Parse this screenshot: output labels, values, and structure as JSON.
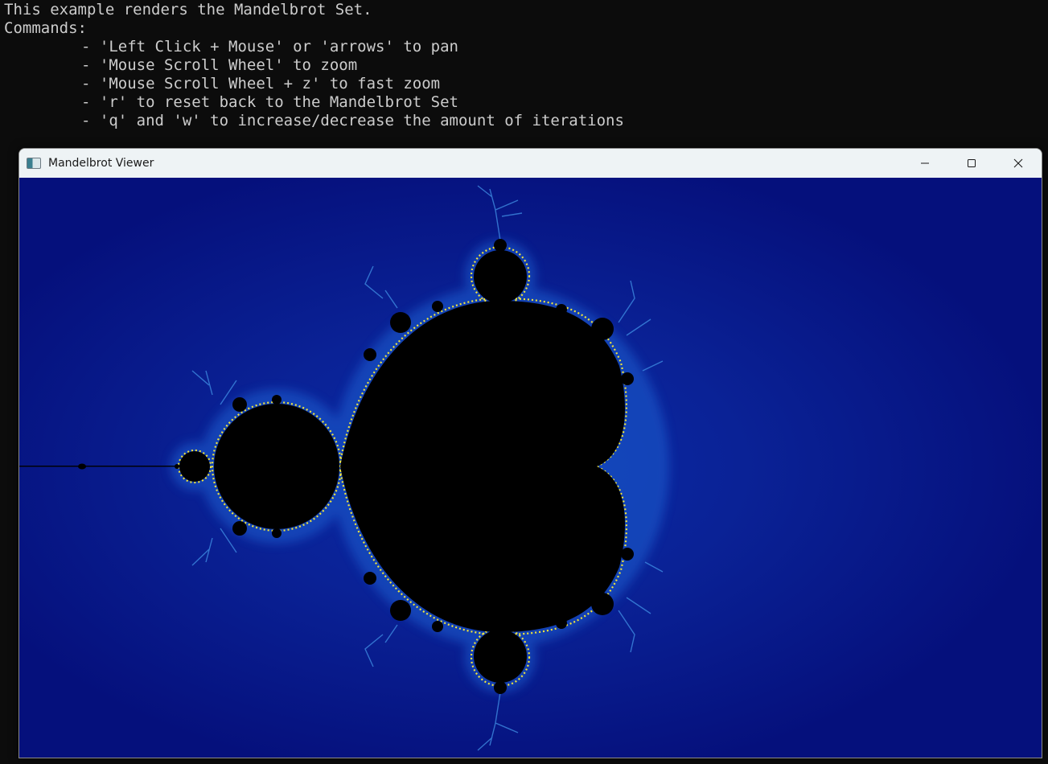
{
  "console": {
    "lines": {
      "intro": "This example renders the Mandelbrot Set.",
      "commands_header": "Commands:",
      "cmd_pan": "- 'Left Click + Mouse' or 'arrows' to pan",
      "cmd_zoom": "- 'Mouse Scroll Wheel' to zoom",
      "cmd_fast_zoom": "- 'Mouse Scroll Wheel + z' to fast zoom",
      "cmd_reset": "- 'r' to reset back to the Mandelbrot Set",
      "cmd_iterations": "- 'q' and 'w' to increase/decrease the amount of iterations"
    }
  },
  "window": {
    "title": "Mandelbrot Viewer",
    "icon": "app-window-icon",
    "controls": {
      "minimize": "minimize-icon",
      "maximize": "maximize-icon",
      "close": "close-icon"
    }
  },
  "colors": {
    "console_background": "#0c0c0c",
    "console_text": "#cccccc",
    "titlebar": "#eef3f5",
    "fractal_background": "#05107c",
    "fractal_glow": "#1d5fd0",
    "fractal_edge": "#f2e63a",
    "fractal_set": "#000000"
  }
}
